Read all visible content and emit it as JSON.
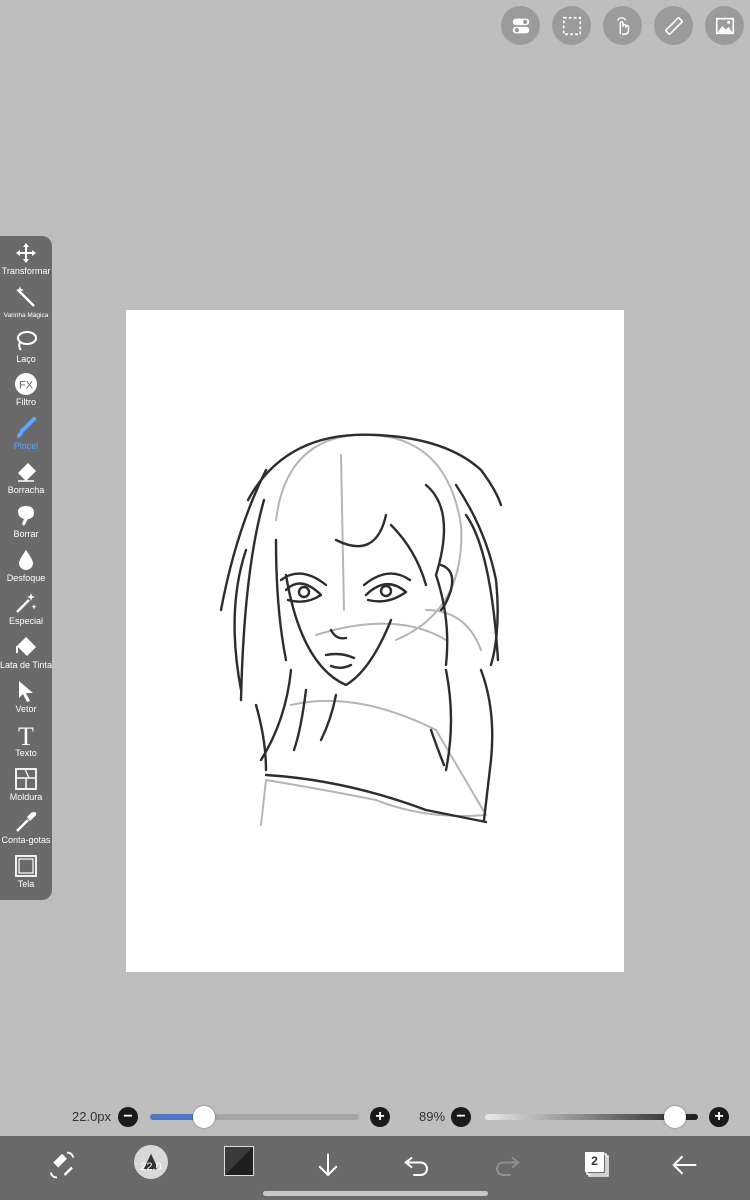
{
  "top_buttons": [
    {
      "icon": "toggle-icon"
    },
    {
      "icon": "selection-icon"
    },
    {
      "icon": "touch-icon"
    },
    {
      "icon": "ruler-icon"
    },
    {
      "icon": "image-icon"
    }
  ],
  "toolbar": {
    "items": [
      {
        "label": "Transformar",
        "icon": "move-icon"
      },
      {
        "label": "Varinha Mágica",
        "icon": "magic-wand-icon"
      },
      {
        "label": "Laço",
        "icon": "lasso-icon"
      },
      {
        "label": "Filtro",
        "icon": "fx-icon",
        "icon_text": "FX"
      },
      {
        "label": "Pincel",
        "icon": "brush-icon",
        "active": true
      },
      {
        "label": "Borracha",
        "icon": "eraser-icon"
      },
      {
        "label": "Borrar",
        "icon": "smudge-icon"
      },
      {
        "label": "Desfoque",
        "icon": "blur-drop-icon"
      },
      {
        "label": "Especial",
        "icon": "special-icon"
      },
      {
        "label": "Lata de Tinta",
        "icon": "paint-bucket-icon"
      },
      {
        "label": "Vetor",
        "icon": "vector-arrow-icon"
      },
      {
        "label": "Texto",
        "icon": "text-icon",
        "icon_text": "T"
      },
      {
        "label": "Moldura",
        "icon": "frame-icon"
      },
      {
        "label": "Conta-gotas",
        "icon": "eyedropper-icon"
      },
      {
        "label": "Tela",
        "icon": "canvas-icon"
      }
    ],
    "active_color": "#5ea6ff"
  },
  "brush_size": {
    "value_text": "22.0px",
    "minus": "−",
    "plus": "+",
    "level": 0.26
  },
  "opacity": {
    "value_text": "89%",
    "minus": "−",
    "plus": "+",
    "level": 0.89
  },
  "bottom_bar": {
    "brush_preview_text": "22.0",
    "layer_count": "2",
    "color_swatch": "#1f1f1f"
  },
  "colors": {
    "background": "#bebebe",
    "toolbar": "#6a6a6a",
    "accent": "#4f78c4"
  }
}
